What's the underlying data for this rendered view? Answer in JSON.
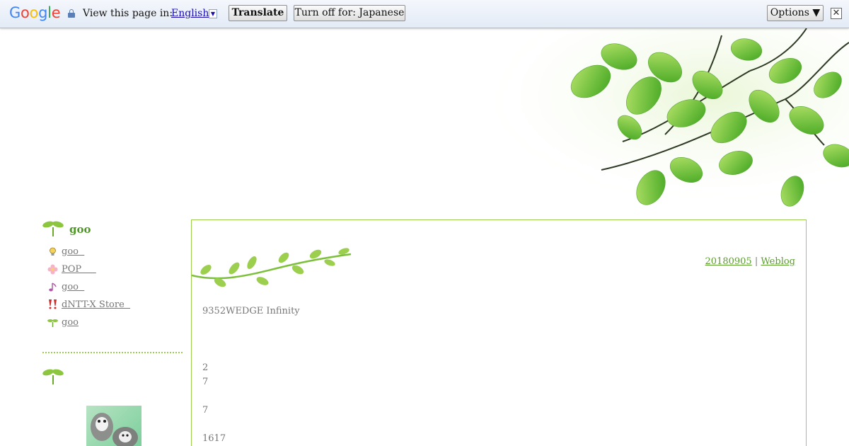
{
  "translate_bar": {
    "logo_letters": [
      {
        "char": "G",
        "color": "#4285f4"
      },
      {
        "char": "o",
        "color": "#ea4335"
      },
      {
        "char": "o",
        "color": "#fbbc05"
      },
      {
        "char": "g",
        "color": "#4285f4"
      },
      {
        "char": "l",
        "color": "#34a853"
      },
      {
        "char": "e",
        "color": "#ea4335"
      }
    ],
    "view_label": "View this page in:",
    "language": "English",
    "language_arrow": "▼",
    "translate_button": "Translate",
    "turn_off_button": "Turn off for: Japanese",
    "options_button": "Options ▼",
    "close_button": "✕"
  },
  "sidebar": {
    "title": "goo",
    "items": [
      {
        "label": "goo  ",
        "icon": "lightbulb-icon"
      },
      {
        "label": "POP     ",
        "icon": "flower-icon"
      },
      {
        "label": "goo  ",
        "icon": "music-note-icon"
      },
      {
        "label": "dNTT-X Store  ",
        "icon": "exclamation-icon"
      },
      {
        "label": "goo",
        "icon": "sprout-icon"
      }
    ]
  },
  "post": {
    "date_link": "20180905",
    "separator": "|",
    "category_link": "Weblog",
    "title_line": "9352WEDGE Infinity",
    "lines": [
      "2",
      "7",
      "7",
      "1617"
    ]
  },
  "colors": {
    "accent_green": "#4f9a24",
    "border_green": "#9ccf4e",
    "link_blue": "#1a0dab"
  }
}
